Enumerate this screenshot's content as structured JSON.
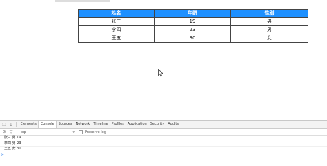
{
  "table": {
    "headers": [
      "姓名",
      "年龄",
      "性别"
    ],
    "rows": [
      [
        "张三",
        "19",
        "男"
      ],
      [
        "李四",
        "23",
        "男"
      ],
      [
        "王五",
        "30",
        "女"
      ]
    ]
  },
  "devtools": {
    "tabs": [
      "Elements",
      "Console",
      "Sources",
      "Network",
      "Timeline",
      "Profiles",
      "Application",
      "Security",
      "Audits"
    ],
    "active_tab": "Console",
    "frame": "top",
    "preserve_log": "Preserve log",
    "console_lines": [
      "张三 男 19",
      "李四 男 23",
      "王五 女 30"
    ],
    "prompt": ">"
  },
  "colors": {
    "header_bg": "#1e90ff"
  }
}
